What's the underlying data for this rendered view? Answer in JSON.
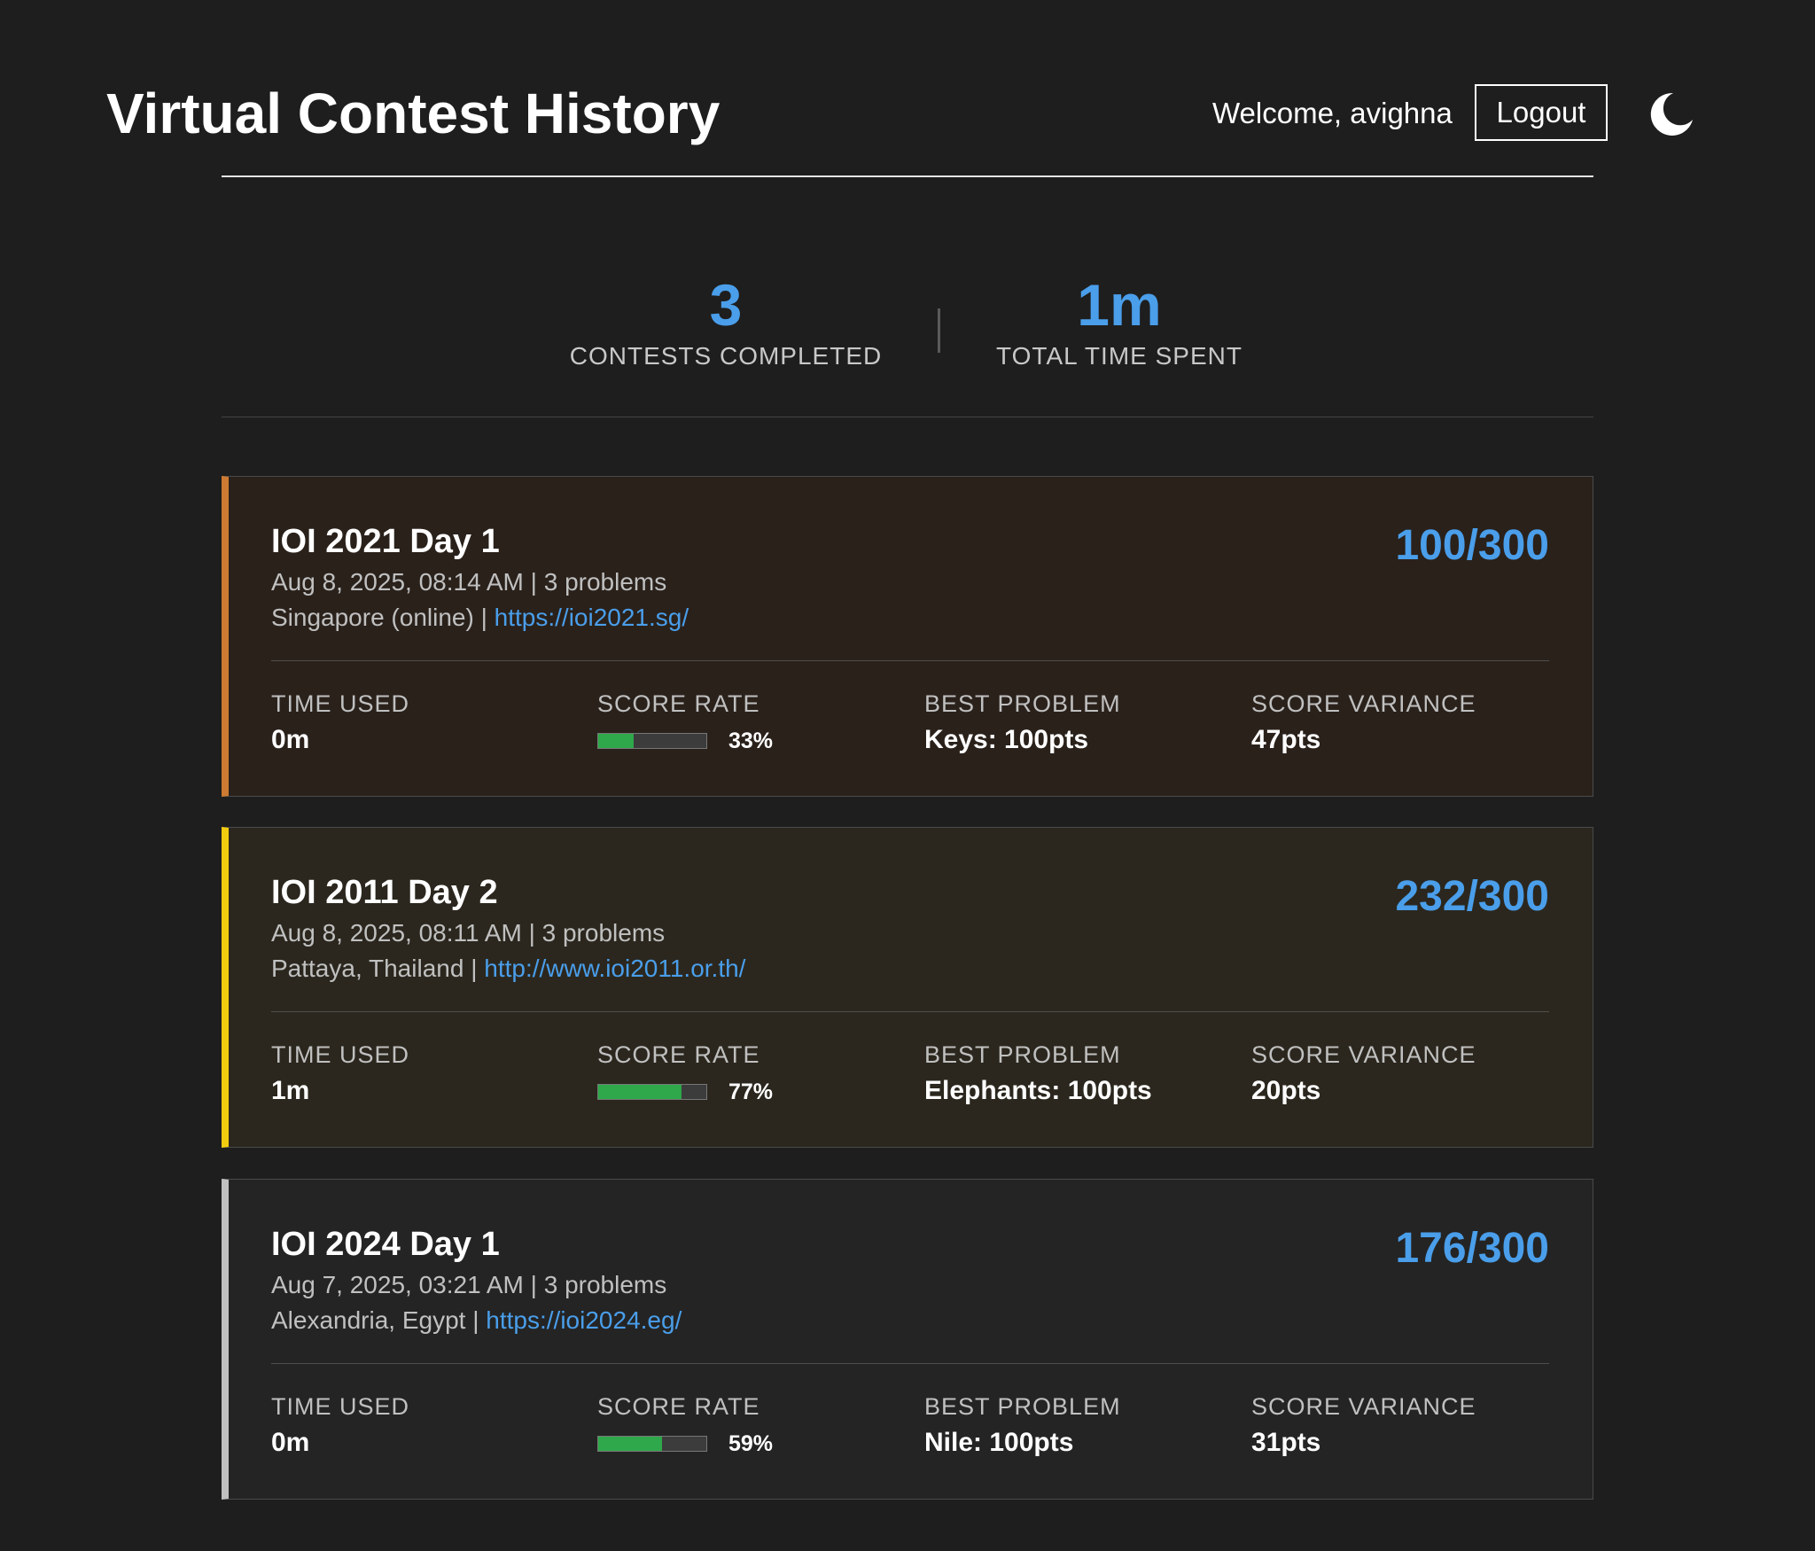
{
  "header": {
    "title": "Virtual Contest History",
    "welcome": "Welcome, avighna",
    "logout_label": "Logout",
    "theme_icon": "moon-icon"
  },
  "stats": {
    "contests_completed_value": "3",
    "contests_completed_label": "CONTESTS COMPLETED",
    "time_spent_value": "1m",
    "time_spent_label": "TOTAL TIME SPENT"
  },
  "labels": {
    "time_used": "TIME USED",
    "score_rate": "SCORE RATE",
    "best_problem": "BEST PROBLEM",
    "score_variance": "SCORE VARIANCE"
  },
  "colors": {
    "background": "#1e1e1e",
    "accent_blue": "#4a9eea",
    "progress_green": "#2ea84a"
  },
  "contests": [
    {
      "title": "IOI 2021 Day 1",
      "score": "100/300",
      "meta": "Aug 8, 2025, 08:14 AM | 3 problems",
      "location": "Singapore (online) | ",
      "url": "https://ioi2021.sg/",
      "time_used": "0m",
      "score_rate": "33%",
      "score_rate_fraction": 0.33,
      "best_problem": "Keys: 100pts",
      "score_variance": "47pts",
      "accent_color": "#cd7b32",
      "card_bg": "#2a211b"
    },
    {
      "title": "IOI 2011 Day 2",
      "score": "232/300",
      "meta": "Aug 8, 2025, 08:11 AM | 3 problems",
      "location": "Pattaya, Thailand | ",
      "url": "http://www.ioi2011.or.th/",
      "time_used": "1m",
      "score_rate": "77%",
      "score_rate_fraction": 0.77,
      "best_problem": "Elephants: 100pts",
      "score_variance": "20pts",
      "accent_color": "#f2cc0f",
      "card_bg": "#2b271e"
    },
    {
      "title": "IOI 2024 Day 1",
      "score": "176/300",
      "meta": "Aug 7, 2025, 03:21 AM | 3 problems",
      "location": "Alexandria, Egypt | ",
      "url": "https://ioi2024.eg/",
      "time_used": "0m",
      "score_rate": "59%",
      "score_rate_fraction": 0.59,
      "best_problem": "Nile: 100pts",
      "score_variance": "31pts",
      "accent_color": "#c0c0c0",
      "card_bg": "#242424"
    }
  ]
}
